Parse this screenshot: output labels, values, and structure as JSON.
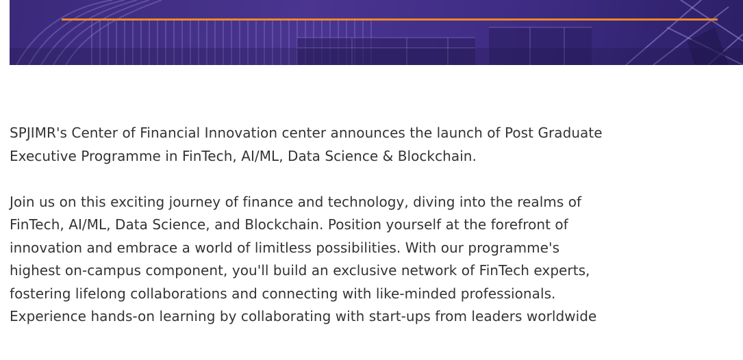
{
  "hero": {
    "banner_image": "building-facade-purple-overlay",
    "accent_rule_color": "#f08a24"
  },
  "article": {
    "paragraph1_lines": [
      "SPJIMR's Center of Financial Innovation center announces the launch of Post Graduate",
      "Executive Programme in FinTech, AI/ML, Data Science & Blockchain."
    ],
    "paragraph2_lines": [
      "Join us on this exciting journey of finance and technology, diving into the realms of",
      "FinTech, AI/ML, Data Science, and Blockchain. Position yourself at the forefront of",
      "innovation and embrace a world of limitless possibilities. With our programme's",
      "highest on-campus component, you'll build an exclusive network of FinTech experts,",
      "fostering lifelong collaborations and connecting with like-minded professionals.",
      "Experience hands-on learning by collaborating with start-ups from leaders worldwide"
    ]
  }
}
